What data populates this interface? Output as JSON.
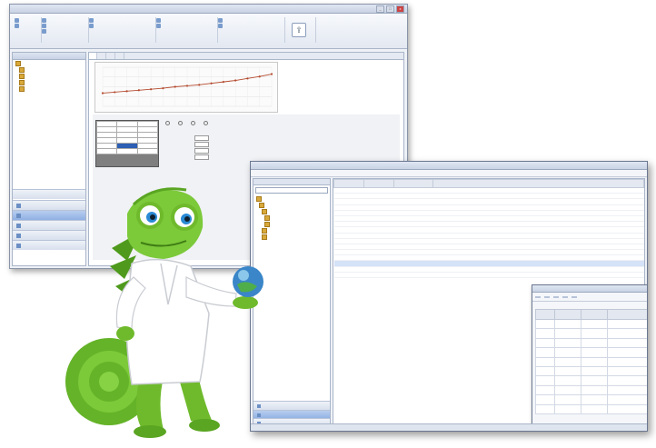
{
  "windowA": {
    "title": "",
    "controls": [
      "_",
      "□",
      "x"
    ],
    "ribbon": {
      "groups": [
        {
          "buttons": [
            "",
            ""
          ]
        },
        {
          "buttons": [
            "",
            "",
            ""
          ]
        },
        {
          "buttons": [
            "",
            ""
          ]
        },
        {
          "buttons": [
            "",
            ""
          ]
        },
        {
          "buttons": [
            "",
            ""
          ]
        }
      ],
      "big_button_icon": "export-icon"
    },
    "left_pane": {
      "tree_items": [
        "",
        "",
        "",
        "",
        ""
      ],
      "nav_buttons": [
        "",
        "",
        "",
        "",
        "",
        ""
      ],
      "active_nav_index": 1
    },
    "tabs": [
      "",
      "",
      "",
      ""
    ],
    "active_tab_index": 0,
    "chart_data": {
      "type": "line",
      "x": [
        1,
        2,
        3,
        4,
        5,
        6,
        7,
        8,
        9,
        10,
        11,
        12,
        13,
        14,
        15
      ],
      "series": [
        {
          "values": [
            27,
            29,
            31,
            33,
            35,
            37,
            40,
            42,
            44,
            47,
            50,
            53,
            57,
            61,
            66
          ],
          "color": "#b44a2e"
        }
      ],
      "title": "",
      "xlabel": "",
      "ylabel": "",
      "ylim": [
        0,
        80
      ],
      "grid": true,
      "legend": "none"
    },
    "grid_table": {
      "headers": [
        "",
        "",
        ""
      ],
      "rows": [
        [
          "",
          "",
          ""
        ],
        [
          "",
          "",
          ""
        ],
        [
          "",
          "",
          ""
        ],
        [
          "",
          "",
          ""
        ],
        [
          "",
          "",
          ""
        ],
        [
          "",
          "",
          ""
        ]
      ]
    },
    "options": [
      "",
      "",
      "",
      ""
    ],
    "fields": [
      {
        "label": "",
        "value": ""
      },
      {
        "label": "",
        "value": ""
      },
      {
        "label": "",
        "value": ""
      },
      {
        "label": "",
        "value": ""
      }
    ]
  },
  "windowB": {
    "title": "",
    "menu": [
      "",
      "",
      "",
      "",
      "",
      "",
      "",
      ""
    ],
    "left_pane": {
      "tree_items": [
        "",
        "",
        "",
        "",
        "",
        "",
        ""
      ],
      "nav_buttons": [
        "",
        "",
        ""
      ],
      "active_nav_index": 1
    },
    "list": {
      "headers": [
        "",
        "",
        "",
        ""
      ],
      "rows": 16,
      "selected_index": 13
    },
    "status": "",
    "dialog": {
      "title": "",
      "tools": [
        "",
        "",
        "",
        "",
        ""
      ],
      "hint": "",
      "headers": [
        "",
        "",
        "",
        "",
        ""
      ],
      "rows": 10,
      "footer": ""
    }
  },
  "mascot": {
    "name": "chameleon-scientist",
    "body_color": "#6fba2c",
    "coat_color": "#ffffff",
    "globe_color": "#3a86c8"
  },
  "colors": {
    "window_bg": "#eef1f6",
    "nav_active": "#9db9e6",
    "selection": "#d5e2f7"
  }
}
